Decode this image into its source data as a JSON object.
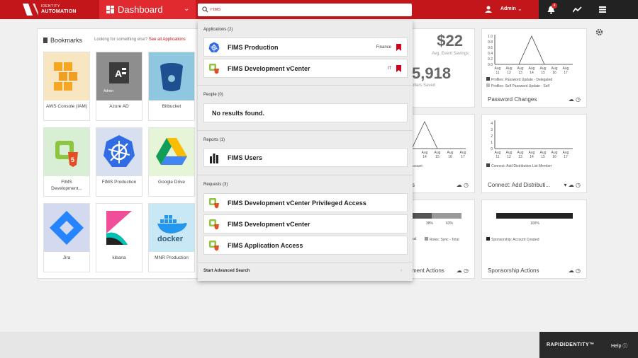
{
  "header": {
    "logo_line1": "IDENTITY",
    "logo_line2": "AUTOMATION",
    "dashboard_label": "Dashboard",
    "search_value": "FIMS",
    "user_name": "Admin",
    "notification_count": "4",
    "brand_color": "#c2161b"
  },
  "bookmarks": {
    "title": "Bookmarks",
    "hint_text": "Looking for something else?",
    "hint_link": "See all Applications",
    "tiles": [
      {
        "name": "AWS Console (IAM)",
        "icon": "aws-icon"
      },
      {
        "name": "Azure AD",
        "icon": "azure-ad-icon",
        "badge": "Admin"
      },
      {
        "name": "Bitbucket",
        "icon": "bitbucket-icon"
      },
      {
        "name": "FIMS Development...",
        "icon": "vcenter-icon"
      },
      {
        "name": "FIMS Production",
        "icon": "kubernetes-icon"
      },
      {
        "name": "Google Drive",
        "icon": "google-drive-icon"
      },
      {
        "name": "Jira",
        "icon": "jira-icon"
      },
      {
        "name": "kibana",
        "icon": "kibana-icon"
      },
      {
        "name": "MNR Production",
        "icon": "docker-icon",
        "logo_text": "docker"
      }
    ]
  },
  "widgets": {
    "savings_value": "$22",
    "savings_label": "Avg. Event Savings",
    "total_value": "5,918",
    "total_label": "ollars Saved",
    "password_changes": {
      "title": "Password Changes",
      "yticks": [
        "1.0",
        "0.8",
        "0.6",
        "0.4",
        "0.2",
        "0.0"
      ],
      "xticks": [
        "Aug 11",
        "Aug 12",
        "Aug 13",
        "Aug 14",
        "Aug 15",
        "Aug 16",
        "Aug 17"
      ],
      "legend": [
        "Profiles: Password Update - Delegated",
        "Profiles: Self Password Update - Self"
      ]
    },
    "mid_left_chart": {
      "xticks": [
        "Aug 14",
        "Aug 15",
        "Aug 16",
        "Aug 17"
      ],
      "legend": "ccount",
      "footer": "s"
    },
    "connect": {
      "title": "Connect: Add Distributi...",
      "yticks": [
        "4",
        "3",
        "2",
        "1",
        "0"
      ],
      "xticks": [
        "Aug 11",
        "Aug 12",
        "Aug 13",
        "Aug 14",
        "Aug 15",
        "Aug 16",
        "Aug 17"
      ],
      "legend": "Connect: Add Distribution List Member"
    },
    "roles": {
      "pct1": "38%",
      "pct2": "63%",
      "legend1": "sal",
      "legend2": "Roles: Sync - Total",
      "title": "ment Actions"
    },
    "sponsorship": {
      "pct": "100%",
      "legend": "Sponsorship: Account Created",
      "title": "Sponsorship Actions"
    }
  },
  "search_results": {
    "applications_header": "Applications (2)",
    "applications": [
      {
        "label": "FIMS Production",
        "tag": "Finance",
        "icon": "kubernetes-icon"
      },
      {
        "label": "FIMS Development vCenter",
        "tag": "IT",
        "icon": "vcenter-icon"
      }
    ],
    "people_header": "People (0)",
    "people_empty": "No results found.",
    "reports_header": "Reports (1)",
    "reports": [
      {
        "label": "FIMS Users",
        "icon": "bar-chart-icon"
      }
    ],
    "requests_header": "Requests (3)",
    "requests": [
      {
        "label": "FIMS Development vCenter Privileged Access",
        "icon": "vcenter-icon"
      },
      {
        "label": "FIMS Development vCenter",
        "icon": "vcenter-icon"
      },
      {
        "label": "FIMS Application Access",
        "icon": "vcenter-icon"
      }
    ],
    "advanced_search": "Start Advanced Search"
  },
  "footer": {
    "brand": "RAPIDIDENTITY™",
    "help": "Help"
  }
}
